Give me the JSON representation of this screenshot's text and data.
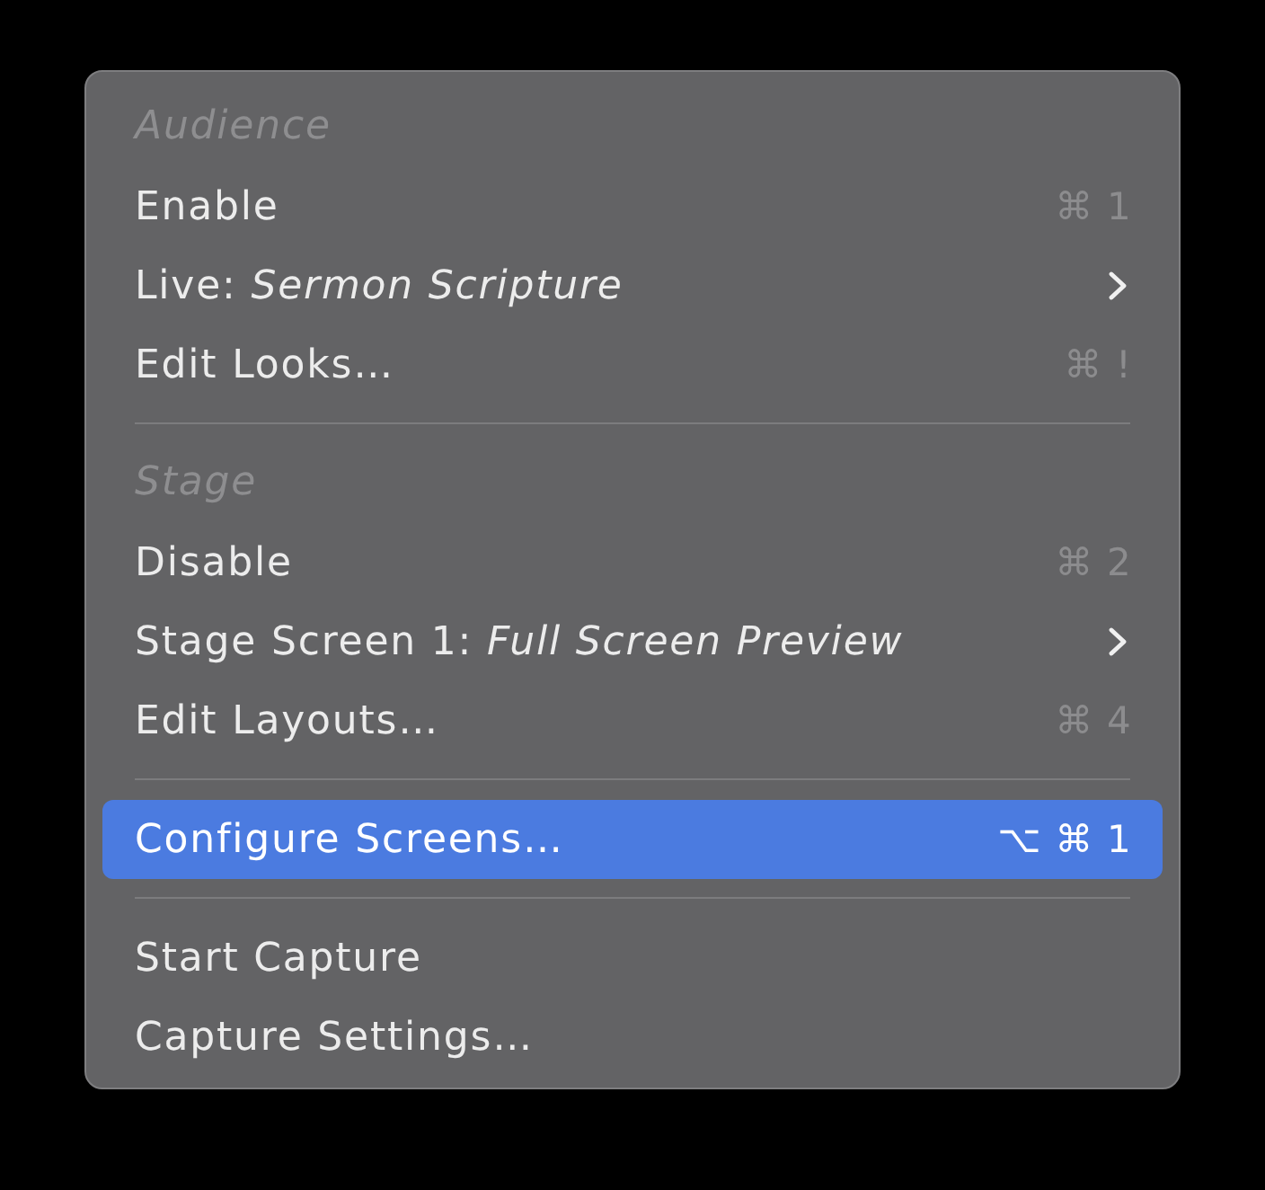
{
  "menu": {
    "sections": [
      {
        "header": "Audience",
        "items": [
          {
            "label": "Enable",
            "shortcut": "⌘ 1",
            "submenu": false,
            "selected": false
          },
          {
            "label": "Live: *Sermon Scripture*",
            "submenu": true,
            "selected": false
          },
          {
            "label": "Edit Looks…",
            "shortcut": "⌘ !",
            "submenu": false,
            "selected": false
          }
        ]
      },
      {
        "header": "Stage",
        "items": [
          {
            "label": "Disable",
            "shortcut": "⌘ 2",
            "submenu": false,
            "selected": false
          },
          {
            "label": "Stage Screen 1: *Full Screen Preview*",
            "submenu": true,
            "selected": false
          },
          {
            "label": "Edit Layouts…",
            "shortcut": "⌘ 4",
            "submenu": false,
            "selected": false
          }
        ]
      },
      {
        "items": [
          {
            "label": "Configure Screens…",
            "shortcut": "⌥ ⌘ 1",
            "submenu": false,
            "selected": true
          }
        ]
      },
      {
        "items": [
          {
            "label": "Start Capture",
            "submenu": false,
            "selected": false
          },
          {
            "label": "Capture Settings…",
            "submenu": false,
            "selected": false
          }
        ]
      }
    ]
  }
}
